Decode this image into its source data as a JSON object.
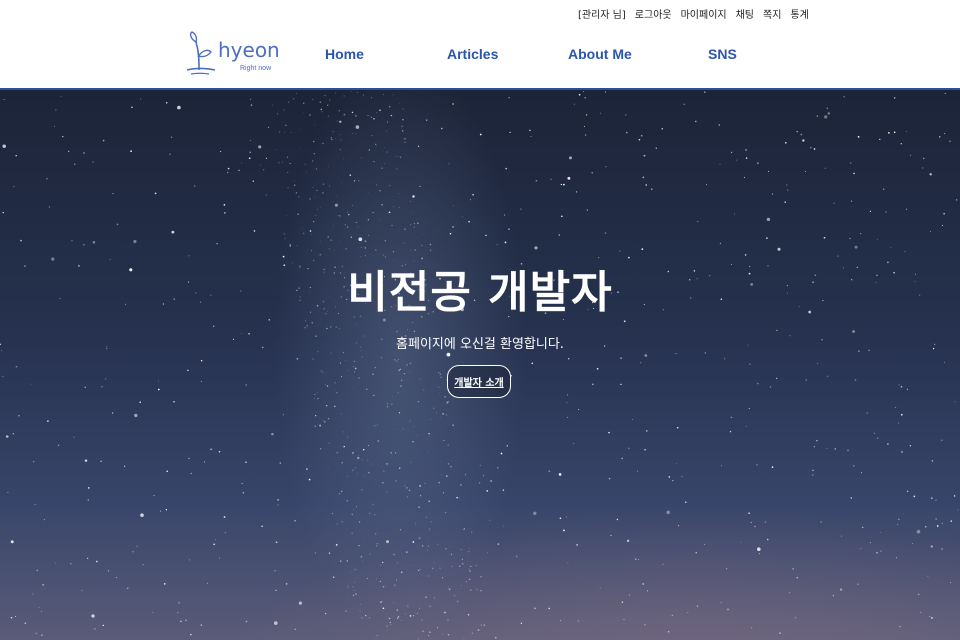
{
  "util_links": [
    "[관리자 님]",
    "로그아웃",
    "마이페이지",
    "채팅",
    "쪽지",
    "통계"
  ],
  "logo": {
    "name": "hyeon",
    "tagline": "Right now",
    "icon": "sprout-icon"
  },
  "nav": [
    "Home",
    "Articles",
    "About Me",
    "SNS"
  ],
  "hero": {
    "title": "비전공 개발자",
    "subtitle": "홈페이지에 오신걸 환영합니다.",
    "button": "개발자 소개"
  },
  "colors": {
    "brand": "#2b55ad",
    "header_line": "#2d4f97",
    "hero_text": "#ffffff"
  }
}
